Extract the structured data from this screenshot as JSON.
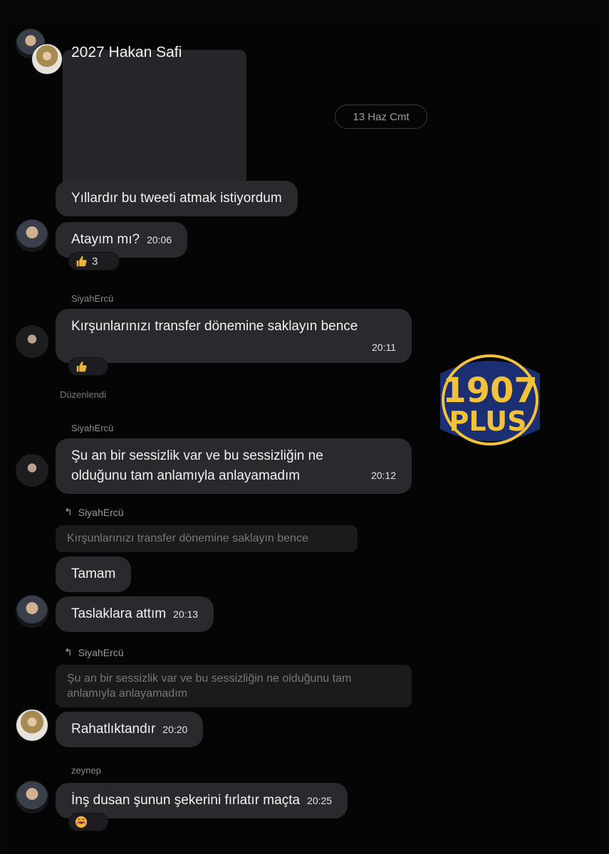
{
  "header": {
    "group_title": "2027 Hakan Safi",
    "date_chip": "13 Haz Cmt"
  },
  "watermark": {
    "logo_top": "1907",
    "logo_bottom": "PLUS"
  },
  "messages": {
    "m1": {
      "text": "Yıllardır bu tweeti atmak istiyordum"
    },
    "m2": {
      "text": "Atayım mı?",
      "time": "20:06",
      "reaction_icon": "thumbs-up",
      "reaction_count": "3"
    },
    "m3": {
      "sender": "SiyahErcü",
      "text": "Kırşunlarınızı transfer dönemine saklayın bence",
      "time": "20:11",
      "reaction_icon": "thumbs-up"
    },
    "edited_label": "Düzenlendi",
    "m4": {
      "sender": "SiyahErcü",
      "line1": "Şu an bir sessizlik var ve bu sessizliğin ne",
      "line2": "olduğunu tam anlamıyla anlayamadım",
      "time": "20:12"
    },
    "m5": {
      "reply_to": "SiyahErcü",
      "quote": "Kırşunlarınızı transfer dönemine saklayın bence",
      "text": "Tamam"
    },
    "m6": {
      "text": "Taslaklara attım",
      "time": "20:13"
    },
    "m7": {
      "reply_to": "SiyahErcü",
      "quote_line1": "Şu an bir sessizlik var ve bu sessizliğin ne olduğunu tam",
      "quote_line2": "anlamıyla anlayamadım",
      "text": "Rahatlıktandır",
      "time": "20:20"
    },
    "m8": {
      "sender": "zeynep",
      "text": "İnş dusan şunun şekerini fırlatır maçta",
      "time": "20:25",
      "reaction_icon": "grinning-face"
    }
  },
  "colors": {
    "background": "#050505",
    "bubble": "#2a2a2e",
    "logo_yellow": "#f2c23a",
    "logo_blue": "#1d2f73"
  }
}
